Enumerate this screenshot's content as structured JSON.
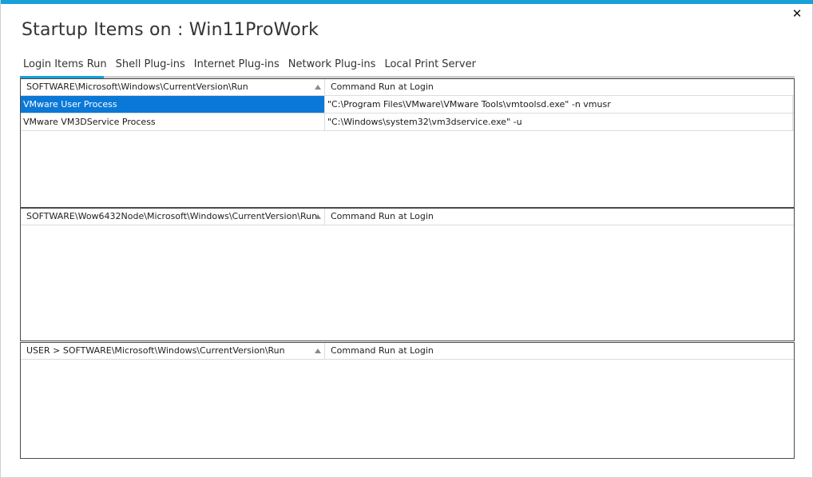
{
  "window": {
    "title": "Startup Items on : Win11ProWork",
    "close_label": "✕",
    "accent_color": "#18a0d8",
    "selection_color": "#0a78d7"
  },
  "tabs": [
    {
      "label": "Login Items Run",
      "active": true
    },
    {
      "label": "Shell Plug-ins",
      "active": false
    },
    {
      "label": "Internet Plug-ins",
      "active": false
    },
    {
      "label": "Network Plug-ins",
      "active": false
    },
    {
      "label": "Local Print Server",
      "active": false
    }
  ],
  "panels": [
    {
      "header": {
        "key": "SOFTWARE\\Microsoft\\Windows\\CurrentVersion\\Run",
        "command": "Command Run at Login"
      },
      "rows": [
        {
          "name": "VMware User Process",
          "command": "\"C:\\Program Files\\VMware\\VMware Tools\\vmtoolsd.exe\" -n vmusr",
          "selected": true
        },
        {
          "name": "VMware VM3DService Process",
          "command": "\"C:\\Windows\\system32\\vm3dservice.exe\" -u",
          "selected": false
        }
      ]
    },
    {
      "header": {
        "key": "SOFTWARE\\Wow6432Node\\Microsoft\\Windows\\CurrentVersion\\Run",
        "command": "Command Run at Login"
      },
      "rows": []
    },
    {
      "header": {
        "key": "USER > SOFTWARE\\Microsoft\\Windows\\CurrentVersion\\Run",
        "command": "Command Run at Login"
      },
      "rows": []
    }
  ]
}
